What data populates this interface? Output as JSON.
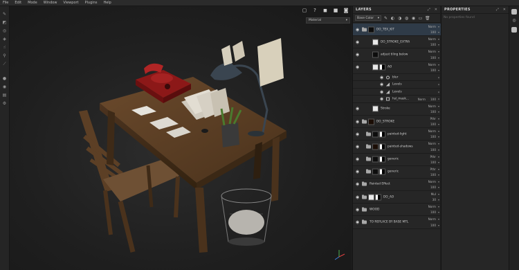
{
  "menu": [
    "File",
    "Edit",
    "Mode",
    "Window",
    "Viewport",
    "Plugins",
    "Help"
  ],
  "tools": [
    "brush-icon",
    "eraser-icon",
    "projection-icon",
    "geometry-mask-icon",
    "smudge-icon",
    "clone-icon",
    "color-picker-icon",
    "bake-icon",
    "material-picker-icon",
    "layers-tool-icon",
    "settings-icon"
  ],
  "viewport": {
    "toolbar_icons": [
      "frame-icon",
      "help-icon",
      "render-icon",
      "camera-icon",
      "screenshot-icon"
    ],
    "material_mode": "Material"
  },
  "layers_panel": {
    "title": "LAYERS",
    "channel": "Base Color",
    "layers": [
      {
        "kind": "folder",
        "name": "DO_TEX_KIT",
        "blend": "Norm",
        "opacity": "100",
        "selected": true,
        "thumb": "d",
        "size": "big"
      },
      {
        "kind": "fill",
        "name": "DO_STROKE_EXTRA",
        "blend": "Norm",
        "opacity": "100",
        "thumb": "w",
        "size": "big",
        "indent": 1
      },
      {
        "kind": "fill",
        "name": "adjust tiling below",
        "blend": "Norm",
        "opacity": "100",
        "thumb": "d",
        "size": "big",
        "indent": 1
      },
      {
        "kind": "fill",
        "name": "AO",
        "blend": "Norm",
        "opacity": "100",
        "thumb": "w",
        "mask": true,
        "size": "big",
        "indent": 1
      },
      {
        "kind": "effect",
        "name": "blur",
        "blend": "",
        "opacity": "",
        "fx": "circle",
        "size": "small"
      },
      {
        "kind": "effect",
        "name": "Levels",
        "blend": "",
        "opacity": "",
        "fx": "bars",
        "size": "small"
      },
      {
        "kind": "effect",
        "name": "Levels",
        "blend": "",
        "opacity": "",
        "fx": "bars",
        "size": "small"
      },
      {
        "kind": "effect",
        "name": "hsl_mask...",
        "blend": "Norm",
        "opacity": "100",
        "fx": "square",
        "size": "small"
      },
      {
        "kind": "fill",
        "name": "Stroke",
        "blend": "Norm",
        "opacity": "100",
        "thumb": "w",
        "size": "big",
        "indent": 1
      },
      {
        "kind": "folder",
        "name": "DO_STROKE",
        "blend": "Pthr",
        "opacity": "100",
        "thumb": "o",
        "size": "big",
        "indent": 0
      },
      {
        "kind": "folder",
        "name": "painted-light",
        "blend": "Norm",
        "opacity": "100",
        "thumb": "d",
        "mask": true,
        "size": "big",
        "indent": 1
      },
      {
        "kind": "folder",
        "name": "painted-shadows",
        "blend": "Norm",
        "opacity": "100",
        "thumb": "o",
        "mask": true,
        "size": "big",
        "indent": 1
      },
      {
        "kind": "folder",
        "name": "generic",
        "blend": "Pthr",
        "opacity": "100",
        "thumb": "d",
        "mask": true,
        "size": "big",
        "indent": 1
      },
      {
        "kind": "folder",
        "name": "generic",
        "blend": "Pthr",
        "opacity": "100",
        "thumb": "d",
        "mask": true,
        "size": "big",
        "indent": 1
      },
      {
        "kind": "folder",
        "name": "Painted Effect",
        "blend": "Norm",
        "opacity": "100",
        "thumb": "",
        "size": "big",
        "indent": 0
      },
      {
        "kind": "folder",
        "name": "DO_AO",
        "blend": "Mul",
        "opacity": "30",
        "thumb": "w",
        "mask": true,
        "size": "big",
        "indent": 0
      },
      {
        "kind": "folder",
        "name": "WOOD",
        "blend": "Norm",
        "opacity": "100",
        "thumb": "",
        "size": "big",
        "indent": 0
      },
      {
        "kind": "folder",
        "name": "TO REPLACE BY BASE MTL",
        "blend": "Norm",
        "opacity": "100",
        "thumb": "",
        "size": "big",
        "indent": 0
      }
    ]
  },
  "properties_panel": {
    "title": "PROPERTIES",
    "empty_text": "No properties found"
  }
}
